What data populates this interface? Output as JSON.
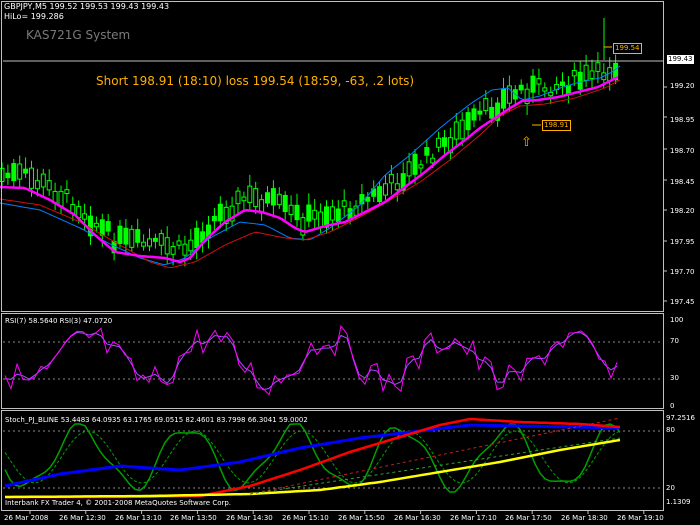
{
  "header": {
    "symbol_line": "GBPJPY,M5  199.52 199.53 199.43 199.43",
    "hilo_line": "HiLo= 199.286"
  },
  "system_label": "KAS721G System",
  "signal_text": "Short 198.91 (18:10) loss 199.54 (18:59, -63, .2 lots)",
  "tags": {
    "entry": "198.91",
    "stop": "199.54",
    "current": "199.43"
  },
  "entry_arrow": "⇧",
  "price_axis": [
    "199.43",
    "199.20",
    "198.95",
    "198.70",
    "198.45",
    "198.20",
    "197.95",
    "197.70",
    "197.45"
  ],
  "rsi": {
    "label": "RSI(7) 58.5640  RSI(3) 47.0720",
    "axis": [
      "100",
      "70",
      "30",
      "0"
    ]
  },
  "stoch": {
    "label": "Stoch_PJ_BLINE 53.4483 64.0935 63.1765 69.0515 82.4601 83.7998 66.3041 59.0002",
    "axis": [
      "97.2516",
      "80",
      "20",
      "1.1309"
    ]
  },
  "copyright": "Interbank FX Trader 4, © 2001-2008 MetaQuotes Software Corp.",
  "time_axis": [
    "26 Mar 2008",
    "26 Mar 12:30",
    "26 Mar 13:10",
    "26 Mar 13:50",
    "26 Mar 14:30",
    "26 Mar 15:10",
    "26 Mar 15:50",
    "26 Mar 16:30",
    "26 Mar 17:10",
    "26 Mar 17:50",
    "26 Mar 18:30",
    "26 Mar 19:10"
  ],
  "colors": {
    "background": "#000000",
    "candle": "#00ff00",
    "ma_magenta": "#ff00ff",
    "ma_red": "#d01010",
    "ma_blue": "#0080ff",
    "signal": "#ffb000",
    "rsi7": "#ff00ff",
    "rsi3": "#a050ff",
    "stoch_fast": "#00a000",
    "stoch_red": "#ff0000",
    "stoch_blue": "#0000ff",
    "stoch_yellow": "#ffff00"
  }
}
